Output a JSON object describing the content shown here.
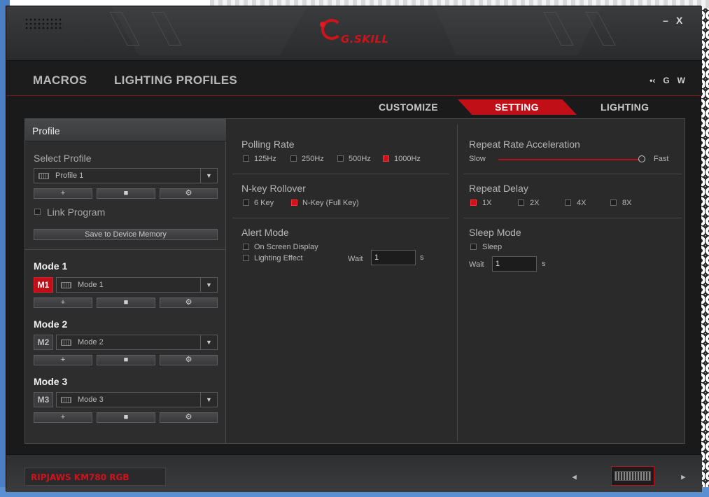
{
  "window": {
    "logo_text": "G.SKILL",
    "minimize_label": "–",
    "close_label": "X"
  },
  "nav": {
    "macros": "MACROS",
    "lighting_profiles": "LIGHTING PROFILES",
    "icons": [
      "•‹",
      "G",
      "W"
    ]
  },
  "subtabs": {
    "customize": "CUSTOMIZE",
    "setting": "SETTING",
    "lighting": "LIGHTING",
    "active": "SETTING"
  },
  "left": {
    "header": "Profile",
    "select_profile_label": "Select Profile",
    "profile_value": "Profile 1",
    "add_glyph": "+",
    "delete_glyph": "■",
    "settings_glyph": "⚙",
    "link_program_label": "Link Program",
    "link_program_checked": false,
    "save_button": "Save to Device Memory",
    "modes": [
      {
        "title": "Mode 1",
        "badge": "M1",
        "value": "Mode 1",
        "active": true
      },
      {
        "title": "Mode 2",
        "badge": "M2",
        "value": "Mode 2",
        "active": false
      },
      {
        "title": "Mode 3",
        "badge": "M3",
        "value": "Mode 3",
        "active": false
      }
    ]
  },
  "settings": {
    "polling_rate": {
      "title": "Polling Rate",
      "options": [
        "125Hz",
        "250Hz",
        "500Hz",
        "1000Hz"
      ],
      "selected": "1000Hz"
    },
    "nkey": {
      "title": "N-key Rollover",
      "options": [
        "6 Key",
        "N-Key (Full Key)"
      ],
      "selected": "N-Key (Full Key)"
    },
    "alert": {
      "title": "Alert Mode",
      "on_screen": "On Screen Display",
      "lighting_effect": "Lighting Effect",
      "wait_label": "Wait",
      "wait_value": "1",
      "unit": "s"
    },
    "repeat_accel": {
      "title": "Repeat Rate Acceleration",
      "min_label": "Slow",
      "max_label": "Fast",
      "value_fraction": 1.0
    },
    "repeat_delay": {
      "title": "Repeat Delay",
      "options": [
        "1X",
        "2X",
        "4X",
        "8X"
      ],
      "selected": "1X"
    },
    "sleep": {
      "title": "Sleep Mode",
      "sleep_label": "Sleep",
      "wait_label": "Wait",
      "wait_value": "1",
      "unit": "s"
    }
  },
  "bottom": {
    "model": "RIPJAWS KM780 RGB",
    "prev_arrow": "◄",
    "next_arrow": "►"
  },
  "colors": {
    "accent": "#c10f18",
    "panel": "#2a2a2b",
    "text": "#b6b6b6"
  }
}
